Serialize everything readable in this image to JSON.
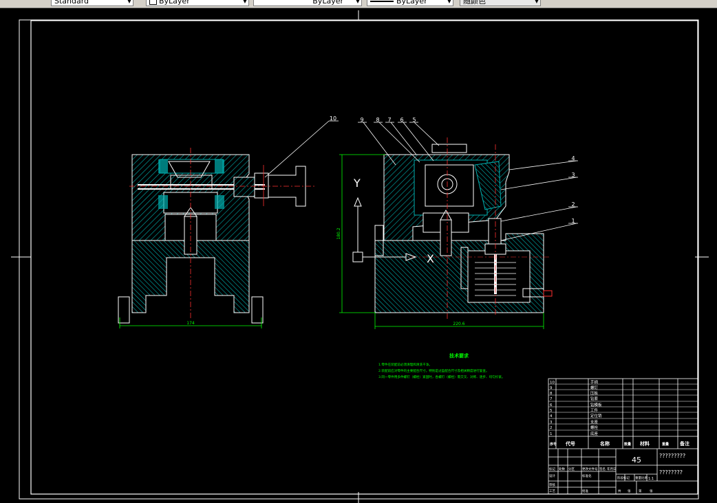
{
  "toolbar": {
    "text_style": "Standard",
    "layer": "ByLayer",
    "linetype": "ByLayer",
    "lineweight": "ByLayer",
    "plot_style": "随颜色"
  },
  "colors": {
    "background": "#000000",
    "outline": "#ffffff",
    "section": "#00b0b0",
    "center": "#ff3030",
    "dimension": "#00ff00",
    "dim_extra": "#ffff00"
  },
  "drawing": {
    "left_view": {
      "width_dim": "174"
    },
    "right_view": {
      "width_dim": "220.6",
      "height_dim": "180.2",
      "axis_y": "Y",
      "axis_x": "X"
    },
    "part_callouts": [
      "10",
      "9",
      "8",
      "7",
      "6",
      "5",
      "4",
      "3",
      "2",
      "1"
    ],
    "tech_notes": {
      "title": "技术要求",
      "lines": [
        "1.零件在装配前必须清理和清洗干净。",
        "2.装配前应对零件的主要配合尺寸，特别是过盈配合尺寸及相关精度进行复查。",
        "3.同一零件用多件螺钉（螺栓）紧固时，各螺钉（螺栓）需交叉、对称、逐步、均匀拧紧。"
      ]
    }
  },
  "title_block": {
    "parts": [
      {
        "no": "10",
        "name": "手柄"
      },
      {
        "no": "9",
        "name": "螺钉"
      },
      {
        "no": "8",
        "name": "压板"
      },
      {
        "no": "7",
        "name": "钻套"
      },
      {
        "no": "6",
        "name": "钻模板"
      },
      {
        "no": "5",
        "name": "工件"
      },
      {
        "no": "4",
        "name": "定位销"
      },
      {
        "no": "3",
        "name": "支座"
      },
      {
        "no": "2",
        "name": "螺栓"
      },
      {
        "no": "1",
        "name": "底座"
      }
    ],
    "header": {
      "no": "序号",
      "code": "代号",
      "name": "名称",
      "qty": "数量",
      "material": "材料",
      "weight": "重量",
      "note": "备注"
    },
    "material_value": "45",
    "drawing_name": "?????????",
    "drawing_code": "????????",
    "scale": "1:1",
    "labels": {
      "mark": "标记",
      "count": "处数",
      "zone": "分区",
      "change_doc": "更改文件号",
      "sign": "签名",
      "date": "年月日",
      "design": "设计",
      "standardize": "标准化",
      "stage_mark": "阶段标记",
      "weight": "重量",
      "scale": "比例",
      "review": "审核",
      "process": "工艺",
      "approve": "批准",
      "total": "共",
      "sheet": "张",
      "page": "第"
    }
  }
}
